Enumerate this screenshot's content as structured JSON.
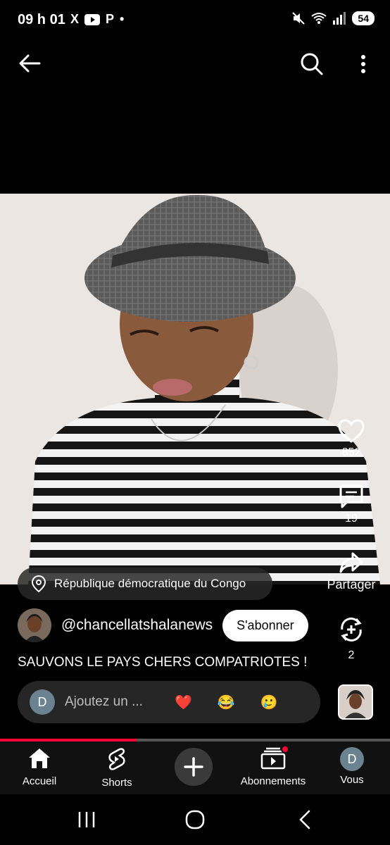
{
  "status_bar": {
    "time": "09 h 01",
    "apps": [
      "X",
      "YouTube",
      "P",
      "•"
    ],
    "battery": "54"
  },
  "video": {
    "location": "République démocratique du Congo"
  },
  "side_actions": {
    "likes": "852",
    "comments": "19",
    "share_label": "Partager",
    "remix_count": "2"
  },
  "channel": {
    "handle": "@chancellatshalanews",
    "subscribe_label": "S'abonner"
  },
  "title": "SAUVONS LE PAYS CHERS COMPATRIOTES !",
  "comment": {
    "avatar_letter": "D",
    "placeholder": "Ajoutez un ...",
    "emojis": [
      "❤️",
      "😂",
      "🥲"
    ]
  },
  "progress": 0.35,
  "bottom_nav": {
    "items": [
      {
        "label": "Accueil"
      },
      {
        "label": "Shorts"
      },
      {
        "label": ""
      },
      {
        "label": "Abonnements"
      },
      {
        "label": "Vous",
        "avatar_letter": "D"
      }
    ]
  },
  "colors": {
    "accent": "#ff0033",
    "background": "#000000"
  }
}
